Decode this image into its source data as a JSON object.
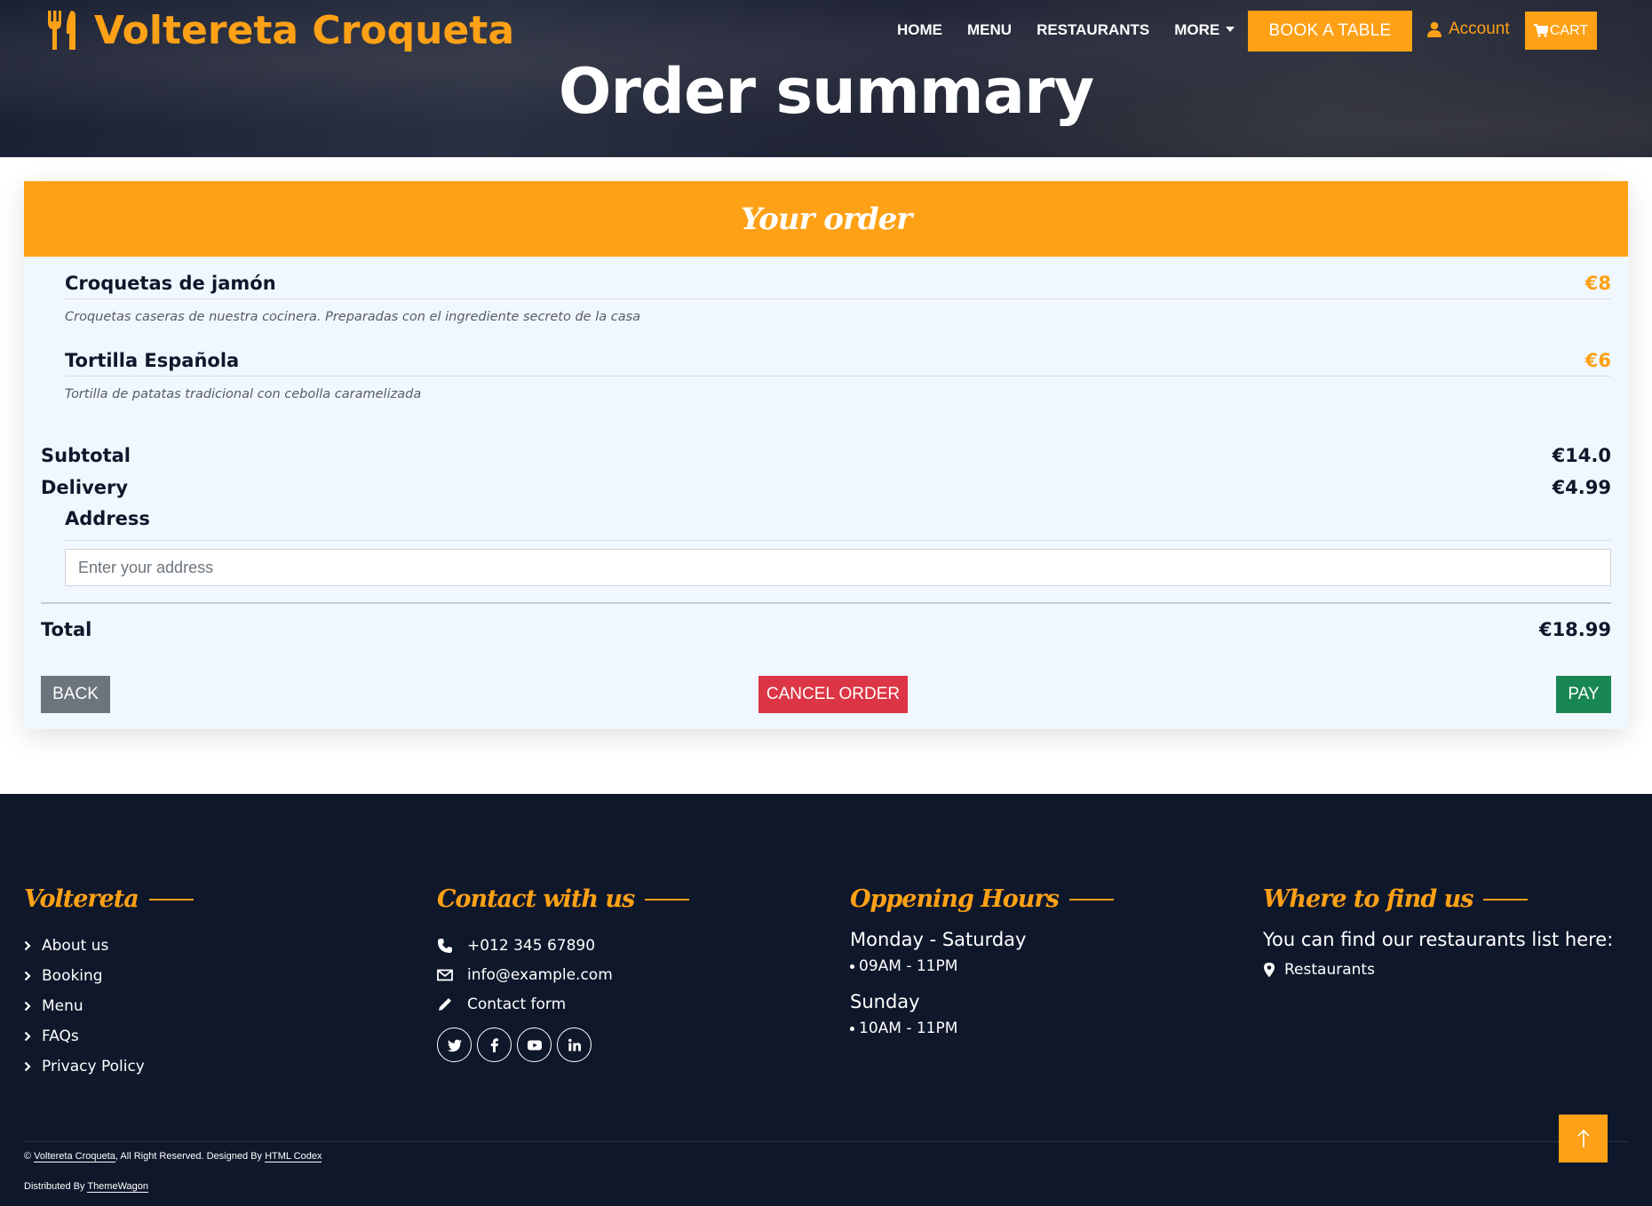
{
  "header": {
    "brand": "Voltereta Croqueta",
    "nav": [
      "HOME",
      "MENU",
      "RESTAURANTS",
      "MORE"
    ],
    "book_label": "BOOK A TABLE",
    "account_label": "Account",
    "cart_label": "CART",
    "page_title": "Order summary"
  },
  "order": {
    "heading": "Your order",
    "items": [
      {
        "name": "Croquetas de jamón",
        "price": "€8",
        "description": "Croquetas caseras de nuestra cocinera. Preparadas con el ingrediente secreto de la casa"
      },
      {
        "name": "Tortilla Española",
        "price": "€6",
        "description": "Tortilla de patatas tradicional con cebolla caramelizada"
      }
    ],
    "subtotal_label": "Subtotal",
    "subtotal_value": "€14.0",
    "delivery_label": "Delivery",
    "delivery_value": "€4.99",
    "address_label": "Address",
    "address_placeholder": "Enter your address",
    "total_label": "Total",
    "total_value": "€18.99",
    "back_label": "BACK",
    "cancel_label": "CANCEL ORDER",
    "pay_label": "PAY"
  },
  "footer": {
    "col1": {
      "heading": "Voltereta",
      "links": [
        "About us",
        "Booking",
        "Menu",
        "FAQs",
        "Privacy Policy"
      ]
    },
    "col2": {
      "heading": "Contact with us",
      "phone": "+012 345 67890",
      "email": "info@example.com",
      "form": "Contact form",
      "social": [
        "twitter-icon",
        "facebook-icon",
        "youtube-icon",
        "linkedin-icon"
      ]
    },
    "col3": {
      "heading": "Oppening Hours",
      "day1": "Monday - Saturday",
      "time1": "09AM - 11PM",
      "day2": "Sunday",
      "time2": "10AM - 11PM"
    },
    "col4": {
      "heading": "Where to find us",
      "text": "You can find our restaurants list here:",
      "link": "Restaurants"
    },
    "copyright_prefix": "©",
    "copyright_brand": "Voltereta Croqueta",
    "copyright_mid": ", All Right Reserved. Designed By",
    "copyright_designer": "HTML Codex",
    "distributed_prefix": "Distributed By",
    "distributed_by": "ThemeWagon"
  },
  "colors": {
    "accent": "#fea116",
    "dark": "#0f172b",
    "card_bg": "#f1f7ff",
    "back": "#6c757d",
    "cancel": "#dc3545",
    "pay": "#198754"
  }
}
